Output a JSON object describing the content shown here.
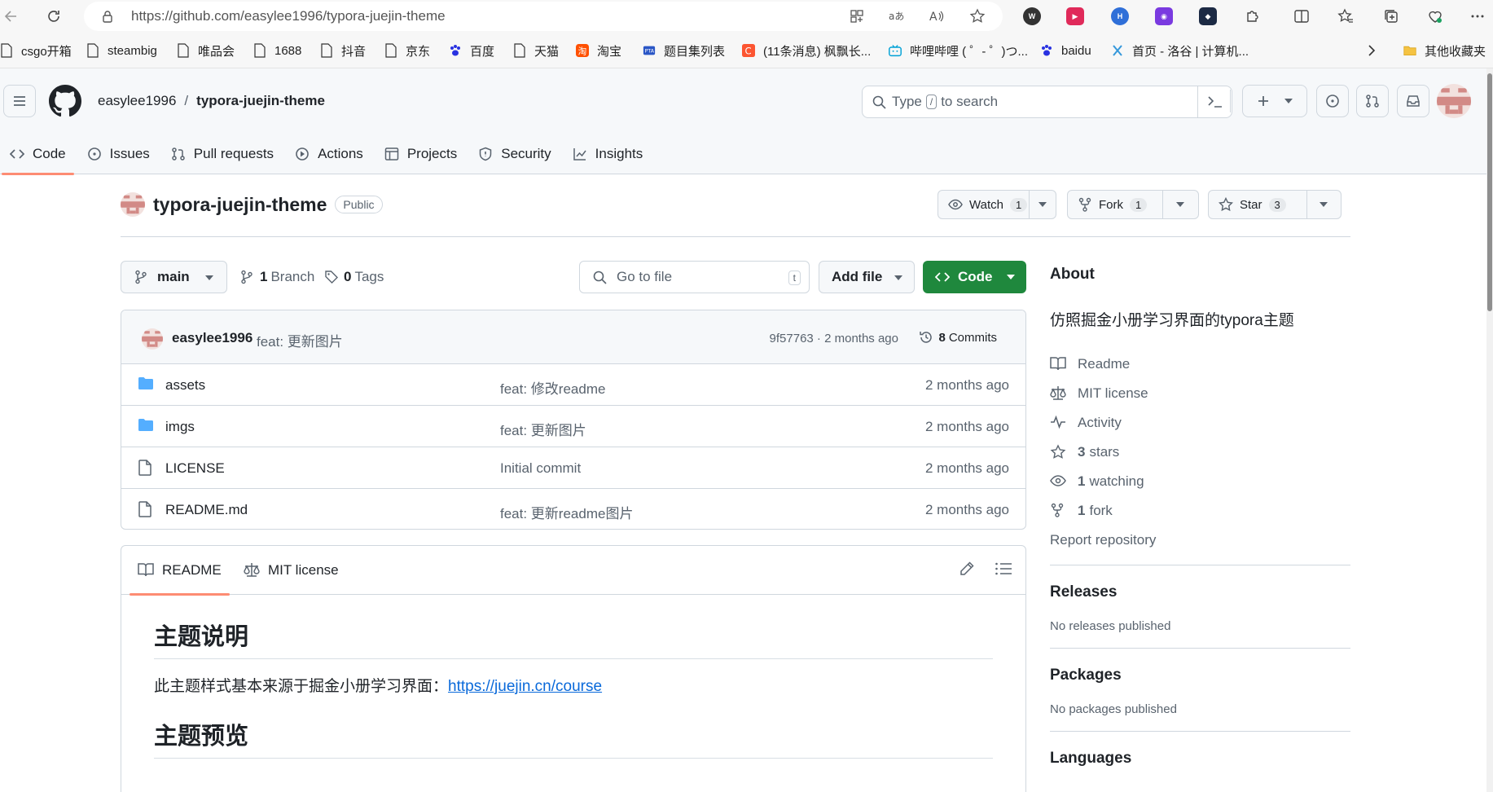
{
  "browser": {
    "url": "https://github.com/easylee1996/typora-juejin-theme",
    "bookmarks": [
      {
        "label": "csgo开箱"
      },
      {
        "label": "steambig"
      },
      {
        "label": "唯品会"
      },
      {
        "label": "1688"
      },
      {
        "label": "抖音"
      },
      {
        "label": "京东"
      },
      {
        "label": "百度"
      },
      {
        "label": "天猫"
      },
      {
        "label": "淘宝"
      },
      {
        "label": "题目集列表"
      },
      {
        "label": "(11条消息) 枫飘长..."
      },
      {
        "label": "哔哩哔哩 ( ゜- ゜)つ..."
      },
      {
        "label": "baidu"
      },
      {
        "label": "首页 - 洛谷 | 计算机..."
      },
      {
        "label": "其他收藏夹"
      }
    ]
  },
  "header": {
    "owner": "easylee1996",
    "separator": "/",
    "repo": "typora-juejin-theme",
    "search_before": "Type",
    "search_key": "/",
    "search_after": "to search"
  },
  "tabs": [
    {
      "label": "Code",
      "icon": "code-icon"
    },
    {
      "label": "Issues",
      "icon": "issue-icon"
    },
    {
      "label": "Pull requests",
      "icon": "pull-request-icon"
    },
    {
      "label": "Actions",
      "icon": "play-icon"
    },
    {
      "label": "Projects",
      "icon": "table-icon"
    },
    {
      "label": "Security",
      "icon": "shield-icon"
    },
    {
      "label": "Insights",
      "icon": "graph-icon"
    }
  ],
  "repo": {
    "name": "typora-juejin-theme",
    "visibility": "Public",
    "watch_label": "Watch",
    "watch_count": "1",
    "fork_label": "Fork",
    "fork_count": "1",
    "star_label": "Star",
    "star_count": "3"
  },
  "toolbar": {
    "branch": "main",
    "branch_count": "1",
    "branch_word": "Branch",
    "tag_count": "0",
    "tag_word": "Tags",
    "goto_placeholder": "Go to file",
    "goto_key": "t",
    "add_file": "Add file",
    "code": "Code"
  },
  "latest_commit": {
    "author": "easylee1996",
    "message": "feat: 更新图片",
    "sha_age": "9f57763 · 2 months ago",
    "commit_count": "8",
    "commit_word": "Commits"
  },
  "files": [
    {
      "name": "assets",
      "type": "dir",
      "message": "feat: 修改readme",
      "age": "2 months ago"
    },
    {
      "name": "imgs",
      "type": "dir",
      "message": "feat: 更新图片",
      "age": "2 months ago"
    },
    {
      "name": "LICENSE",
      "type": "file",
      "message": "Initial commit",
      "age": "2 months ago"
    },
    {
      "name": "README.md",
      "type": "file",
      "message": "feat: 更新readme图片",
      "age": "2 months ago"
    }
  ],
  "readme": {
    "tab_readme": "README",
    "tab_license": "MIT license",
    "heading1": "主题说明",
    "para1": "此主题样式基本来源于掘金小册学习界面：",
    "link1": "https://juejin.cn/course",
    "heading2": "主题预览"
  },
  "sidebar": {
    "about_title": "About",
    "description": "仿照掘金小册学习界面的typora主题",
    "readme": "Readme",
    "license": "MIT license",
    "activity": "Activity",
    "stars_count": "3",
    "stars_word": "stars",
    "watching_count": "1",
    "watching_word": "watching",
    "fork_count": "1",
    "fork_word": "fork",
    "report": "Report repository",
    "releases_title": "Releases",
    "releases_sub": "No releases published",
    "packages_title": "Packages",
    "packages_sub": "No packages published",
    "languages_title": "Languages"
  },
  "colors": {
    "accent_green": "#1f883d",
    "link_blue": "#0969da",
    "tab_underline": "#fd8c73",
    "folder_blue": "#54aeff"
  }
}
